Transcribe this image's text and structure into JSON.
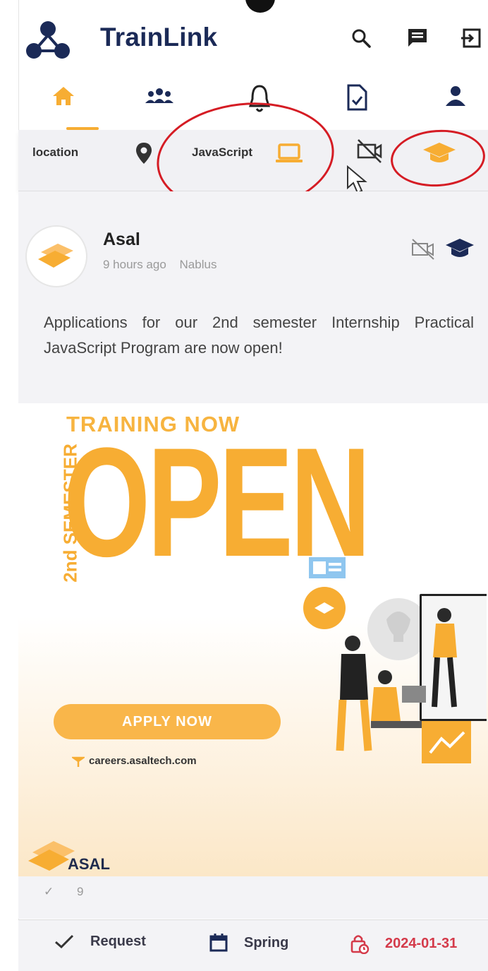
{
  "app": {
    "title": "TrainLink"
  },
  "filters": {
    "location_label": "location",
    "skill_label": "JavaScript"
  },
  "post": {
    "author": "Asal",
    "time": "9 hours ago",
    "city": "Nablus",
    "text": "Applications for our 2nd semester Internship Practical JavaScript Program are now open!",
    "poster": {
      "vertical_text": "2nd SEMESTER",
      "headline": "TRAINING NOW",
      "big_word": "OPEN",
      "button": "APPLY NOW",
      "website": "careers.asaltech.com",
      "brand": "ASAL"
    },
    "actions": {
      "checks": "✓",
      "count": "9"
    }
  },
  "bottom_bar": {
    "request_label": "Request",
    "season_label": "Spring",
    "deadline": "2024-01-31"
  },
  "colors": {
    "brand_navy": "#1b2a57",
    "accent_orange": "#f7ad33",
    "deadline_red": "#d43a4a",
    "annotation_red": "#d51c24"
  }
}
